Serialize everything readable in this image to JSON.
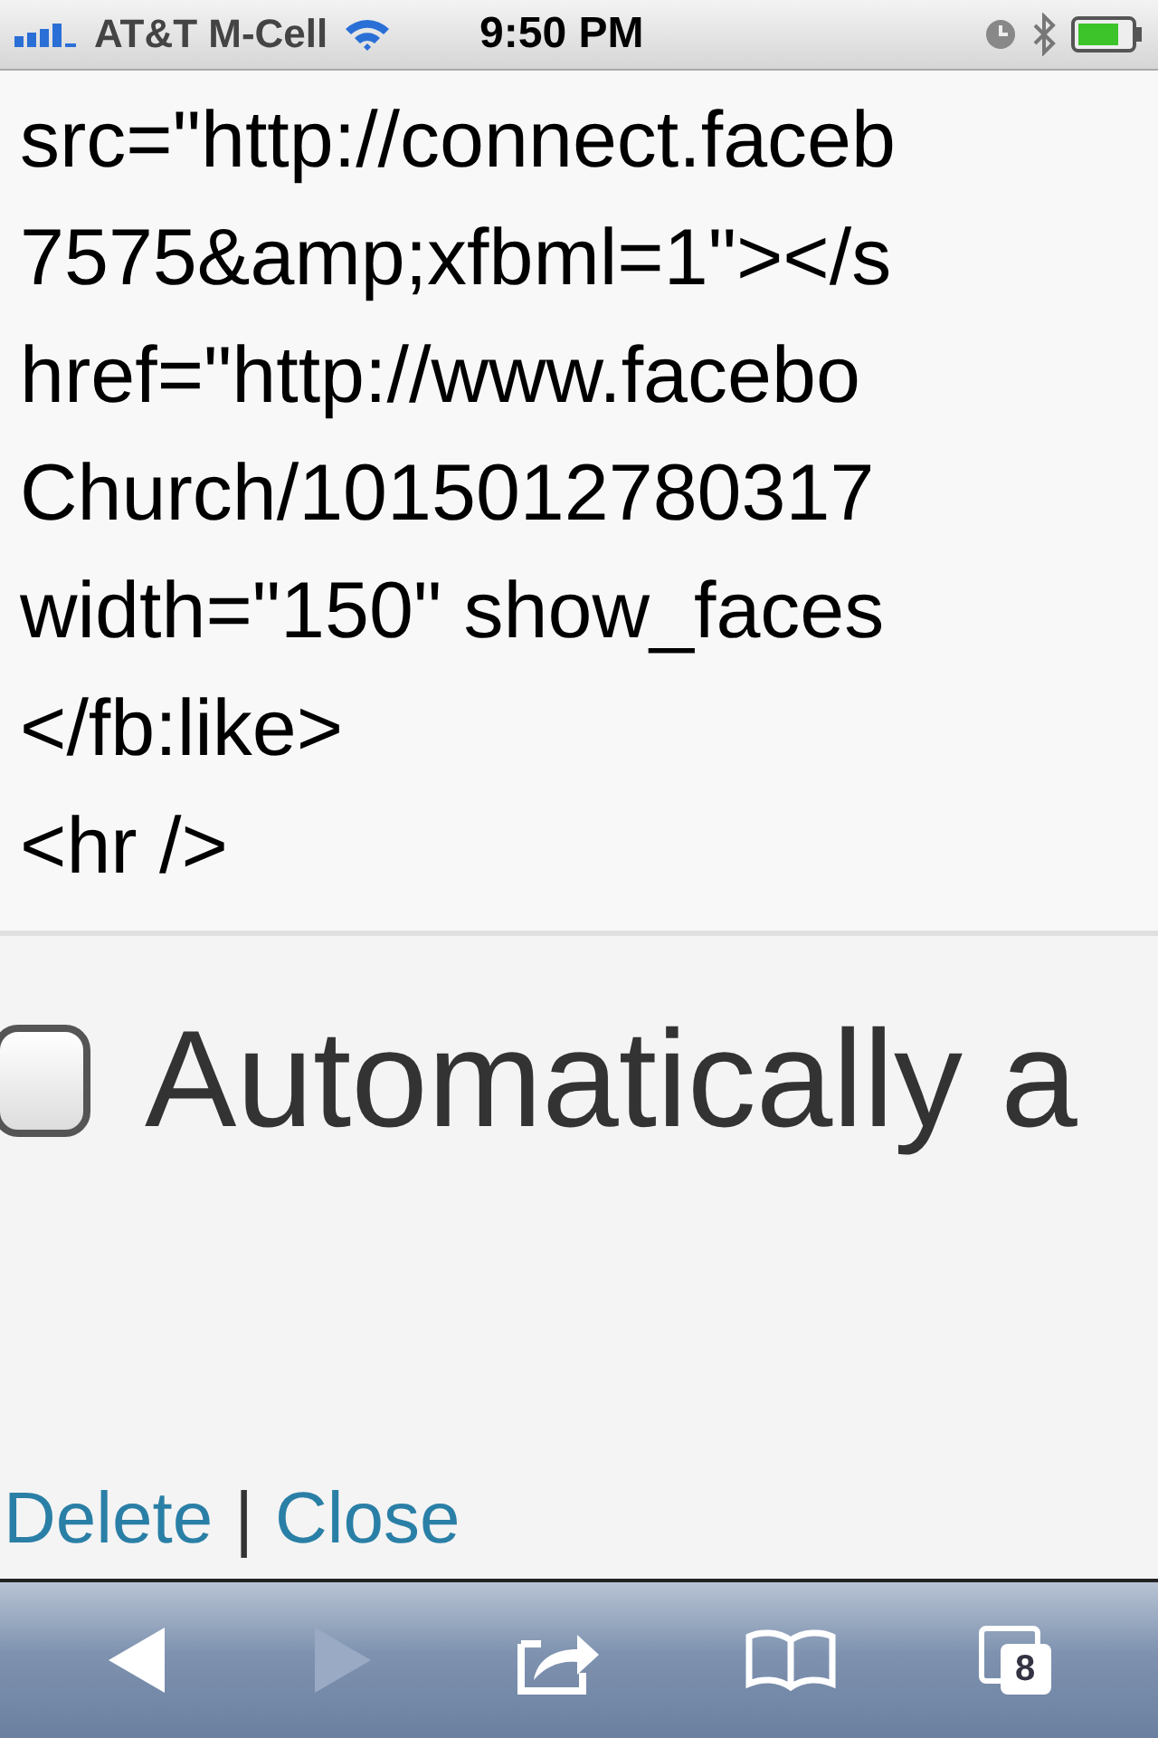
{
  "status_bar": {
    "carrier": "AT&T M-Cell",
    "time": "9:50 PM"
  },
  "code_lines": [
    "src=\"http://connect.faceb",
    "7575&amp;xfbml=1\"></s",
    "href=\"http://www.facebo",
    "Church/1015012780317",
    "width=\"150\" show_faces",
    "</fb:like>",
    "<hr />"
  ],
  "option": {
    "label": "Automatically a",
    "checked": false
  },
  "links": [
    "Delete",
    "|",
    "Close"
  ],
  "toolbar": {
    "back_disabled": false,
    "forward_disabled": true,
    "tab_count": "8"
  }
}
